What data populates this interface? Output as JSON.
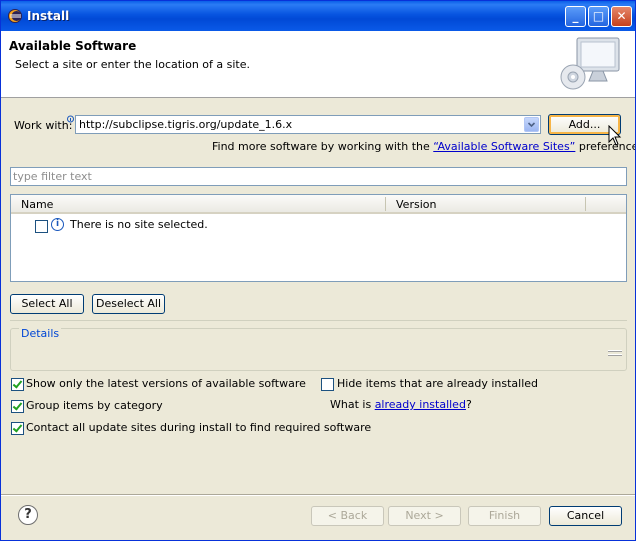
{
  "window": {
    "title": "Install"
  },
  "header": {
    "title": "Available Software",
    "subtitle": "Select a site or enter the location of a site."
  },
  "work_with": {
    "label": "Work with:",
    "value": "http://subclipse.tigris.org/update_1.6.x",
    "add_label": "Add..."
  },
  "sites_hint": {
    "prefix": "Find more software by working with the",
    "link": "“Available Software Sites”",
    "suffix": "preferences."
  },
  "filter": {
    "placeholder": "type filter text"
  },
  "table": {
    "columns": [
      "Name",
      "Version"
    ],
    "rows": [
      {
        "name": "There is no site selected.",
        "version": ""
      }
    ]
  },
  "selection_buttons": {
    "select_all": "Select All",
    "deselect_all": "Deselect All"
  },
  "details": {
    "label": "Details"
  },
  "options": {
    "latest_only": {
      "label": "Show only the latest versions of available software",
      "checked": true
    },
    "group_by_category": {
      "label": "Group items by category",
      "checked": true
    },
    "contact_all_sites": {
      "label": "Contact all update sites during install to find required software",
      "checked": true
    },
    "hide_installed": {
      "label": "Hide items that are already installed",
      "checked": false
    },
    "what_is": {
      "prefix": "What is",
      "link": "already installed",
      "suffix": "?"
    }
  },
  "footer": {
    "back": "< Back",
    "next": "Next >",
    "finish": "Finish",
    "cancel": "Cancel"
  },
  "colors": {
    "titlebar": "#0a5fe8",
    "dialog_bg": "#ece9d8",
    "link": "#0000cc",
    "details_legend": "#0046d5"
  }
}
